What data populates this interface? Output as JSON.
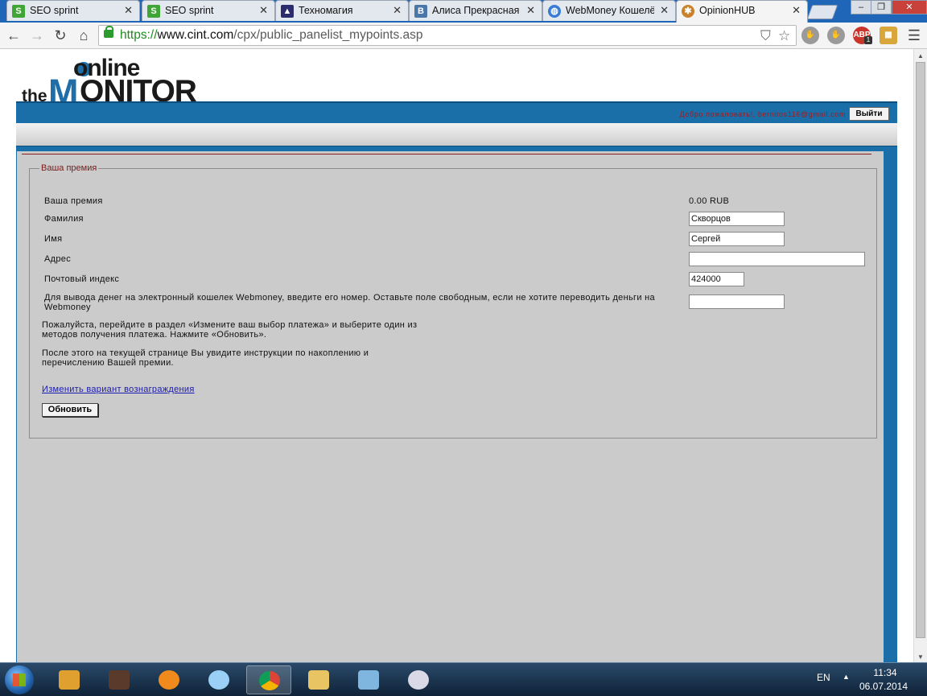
{
  "browser": {
    "tabs": [
      {
        "title": "SEO sprint",
        "icon": "seosprint-icon",
        "color": "#3fa535"
      },
      {
        "title": "SEO sprint",
        "icon": "seosprint-icon",
        "color": "#3fa535"
      },
      {
        "title": "Техномагия",
        "icon": "wizard-hat-icon",
        "color": "#2b2b6e"
      },
      {
        "title": "Алиса Прекрасная",
        "icon": "vk-icon",
        "color": "#4a76a8"
      },
      {
        "title": "WebMoney Кошелё",
        "icon": "globe-icon",
        "color": "#3a7bd5"
      },
      {
        "title": "OpinionHUB",
        "icon": "opinionhub-icon",
        "color": "#c9822b"
      }
    ],
    "active_tab": 5,
    "url": {
      "scheme": "https://",
      "host": "www.cint.com",
      "path": "/cpx/public_panelist_mypoints.asp"
    },
    "extensions": [
      "adblock-icon",
      "abp-icon",
      "puzzle-icon",
      "menu-icon"
    ],
    "abp_label": "ABP",
    "abp_badge": "1"
  },
  "site": {
    "logo": {
      "line1": "online",
      "line2_small": "the",
      "line2_big": "M",
      "line2_rest": "ONITOR"
    },
    "welcome": "Добро пожаловать!, bernitos116@gmail.com",
    "logout_label": "Выйти",
    "colors": {
      "brand_blue": "#1a6fa9",
      "legend_red": "#7b1a1a",
      "content_gray": "#cbcbcb"
    }
  },
  "form": {
    "legend": "Ваша премия",
    "rows": [
      {
        "label": "Ваша премия",
        "value": "0.00 RUB"
      },
      {
        "label": "Фамилия",
        "value": "Скворцов"
      },
      {
        "label": "Имя",
        "value": "Сергей"
      },
      {
        "label": "Адрес",
        "value": ""
      },
      {
        "label": "Почтовый индекс",
        "value": "424000"
      },
      {
        "label": "Для вывода денег на электронный кошелек Webmoney, введите его номер. Оставьте поле свободным, если не хотите переводить деньги на Webmoney",
        "value": ""
      }
    ],
    "para1": "Пожалуйста, перейдите в раздел «Измените ваш выбор платежа» и выберите один из методов получения платежа. Нажмите «Обновить».",
    "para2": "После этого на текущей странице Вы увидите инструкции по накоплению и перечислению Вашей премии.",
    "change_link": "Изменить вариант вознаграждения",
    "update_button": "Обновить"
  },
  "taskbar": {
    "apps": [
      "media-player-icon",
      "game-icon",
      "browser-orange-icon",
      "itunes-icon",
      "chrome-icon",
      "explorer-folder-icon",
      "notepad-icon",
      "paint-icon"
    ],
    "active_app": 4,
    "lang": "EN",
    "time": "11:34",
    "date": "06.07.2014"
  }
}
